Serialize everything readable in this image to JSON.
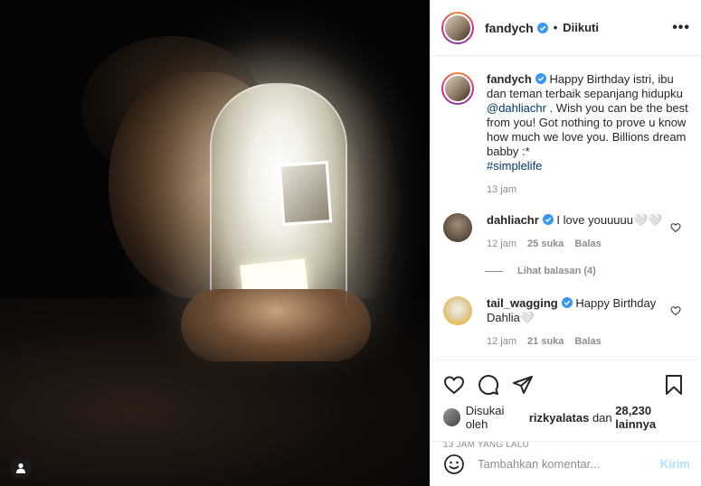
{
  "header": {
    "username": "fandych",
    "separator": "•",
    "follow_state": "Diikuti",
    "more": "•••"
  },
  "caption": {
    "username": "fandych",
    "text_1": "Happy Birthday istri, ibu dan teman terbaik sepanjang hidupku",
    "mention": "@dahliachr",
    "text_2": ". Wish you can be the best from you! Got nothing to prove u know how much we love you. Billions dream babby :*",
    "hashtag": "#simplelife",
    "time": "13 jam"
  },
  "comments": [
    {
      "username": "dahliachr",
      "text": "I love youuuuu🤍🤍",
      "time": "12 jam",
      "likes": "25 suka",
      "reply": "Balas"
    },
    {
      "username": "tail_wagging",
      "text": "Happy Birthday Dahlia🤍",
      "time": "12 jam",
      "likes": "21 suka",
      "reply": "Balas"
    }
  ],
  "view_replies": "Lihat balasan (4)",
  "likes": {
    "prefix": "Disukai oleh",
    "user": "rizkyalatas",
    "middle": "dan",
    "count": "28,230 lainnya"
  },
  "posted": "13 JAM YANG LALU",
  "add_comment": {
    "placeholder": "Tambahkan komentar...",
    "send": "Kirim"
  },
  "colors": {
    "verified": "#3897f0",
    "link": "#00376b",
    "muted": "#8e8e8e",
    "send_disabled": "#b2dffc"
  }
}
